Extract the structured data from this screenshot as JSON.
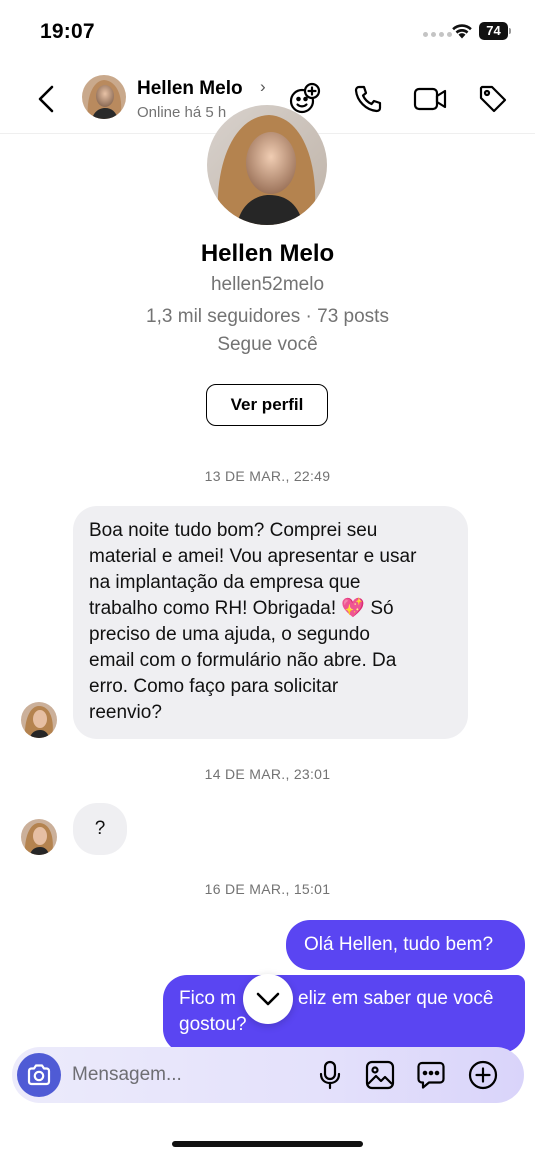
{
  "status_bar": {
    "time": "19:07",
    "battery": "74"
  },
  "header": {
    "name": "Hellen Melo",
    "chevron": "›",
    "status": "Online há 5 h",
    "icons": [
      "back-icon",
      "emoji-add-icon",
      "phone-icon",
      "video-icon",
      "tag-icon"
    ]
  },
  "profile": {
    "name": "Hellen Melo",
    "handle": "hellen52melo",
    "stats": "1,3 mil seguidores · 73 posts",
    "follows": "Segue você",
    "view_button": "Ver perfil"
  },
  "messages": [
    {
      "timestamp": "13 DE MAR., 22:49",
      "sender": "them",
      "text": "Boa noite tudo bom? Comprei seu material e amei! Vou apresentar e usar na implantação da empresa que trabalho como RH! Obrigada! 💖 Só preciso de uma ajuda, o segundo email com o formulário não abre. Da erro. Como faço para solicitar reenvio?",
      "lines": [
        "Boa noite tudo bom? Comprei seu",
        "material e amei! Vou apresentar e usar",
        "na implantação da empresa que",
        "trabalho como RH! Obrigada! 💖 Só",
        "preciso de uma ajuda, o segundo",
        "email com o formulário não abre. Da",
        "erro. Como faço para solicitar",
        "reenvio?"
      ]
    },
    {
      "timestamp": "14 DE MAR., 23:01",
      "sender": "them",
      "text": "?"
    },
    {
      "timestamp": "16 DE MAR., 15:01",
      "sender": "me",
      "text": "Olá Hellen, tudo bem?"
    },
    {
      "sender": "me",
      "text": "Fico muito feliz em saber que você gostou?",
      "lines": [
        "Fico m",
        "eliz em saber que você",
        "gostou?"
      ]
    }
  ],
  "composer": {
    "placeholder": "Mensagem..."
  },
  "colors": {
    "accent": "#5a45f2",
    "bubble_in": "#efeff2",
    "camera": "#4f5bd5",
    "muted": "#737373"
  }
}
